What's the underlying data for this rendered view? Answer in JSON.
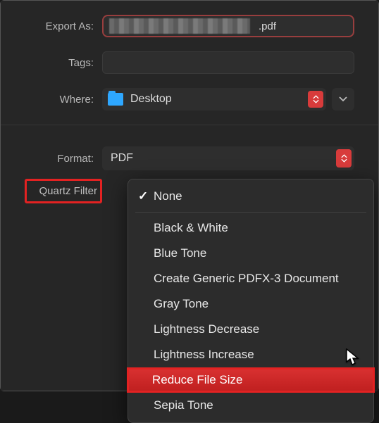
{
  "labels": {
    "export_as": "Export As:",
    "tags": "Tags:",
    "where": "Where:",
    "format": "Format:",
    "quartz_filter": "Quartz Filter"
  },
  "export": {
    "filename_ext": ".pdf"
  },
  "where": {
    "folder_name": "Desktop"
  },
  "format": {
    "selected": "PDF"
  },
  "quartz_filter": {
    "options": {
      "none": "None",
      "black_white": "Black & White",
      "blue_tone": "Blue Tone",
      "create_pdfx3": "Create Generic PDFX-3 Document",
      "gray_tone": "Gray Tone",
      "lightness_decrease": "Lightness Decrease",
      "lightness_increase": "Lightness Increase",
      "reduce_file_size": "Reduce File Size",
      "sepia_tone": "Sepia Tone"
    },
    "selected": "None",
    "highlighted": "Reduce File Size"
  }
}
